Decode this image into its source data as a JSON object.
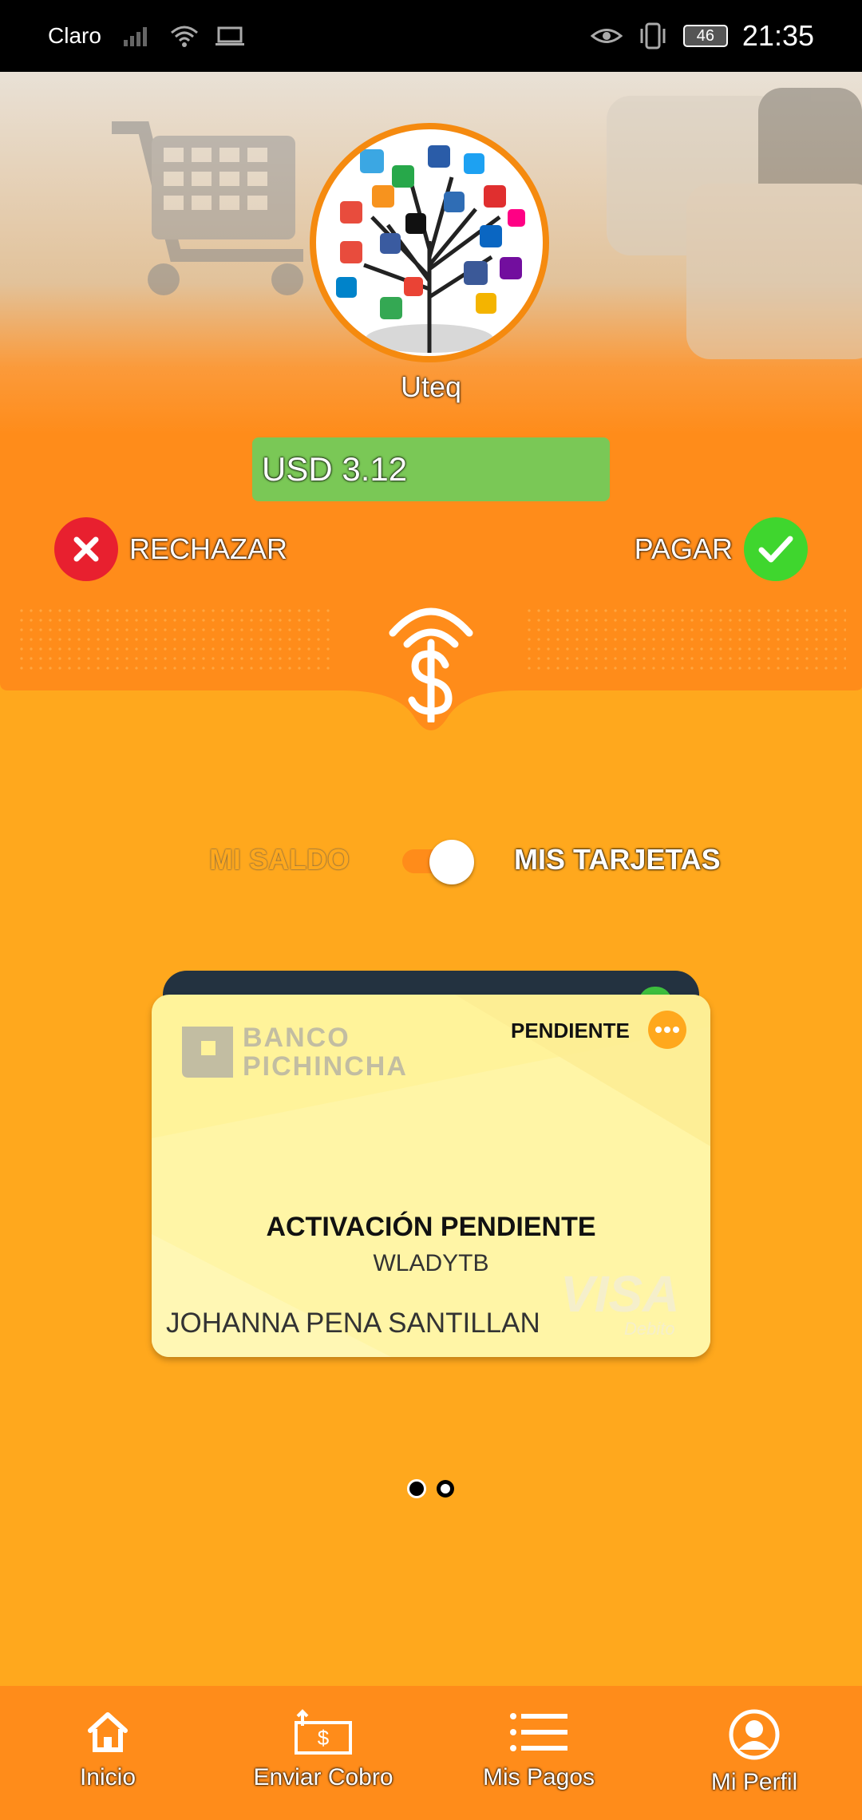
{
  "status_bar": {
    "carrier": "Claro",
    "battery": "46",
    "time": "21:35"
  },
  "merchant": {
    "name": "Uteq",
    "amount": "USD 3.12"
  },
  "actions": {
    "reject_label": "RECHAZAR",
    "pay_label": "PAGAR"
  },
  "toggle": {
    "left_label": "MI SALDO",
    "right_label": "MIS TARJETAS",
    "state": "MIS TARJETAS"
  },
  "card": {
    "bank_line1": "BANCO",
    "bank_line2": "PICHINCHA",
    "status": "PENDIENTE",
    "title": "ACTIVACIÓN PENDIENTE",
    "subtitle": "WLADYTB",
    "holder": "JOHANNA PENA SANTILLAN",
    "brand": "VISA",
    "brand_sub": "Debito"
  },
  "pager": {
    "pages": 2,
    "active": 1
  },
  "bottom_nav": [
    {
      "label": "Inicio",
      "icon": "home-icon"
    },
    {
      "label": "Enviar Cobro",
      "icon": "send-money-icon"
    },
    {
      "label": "Mis Pagos",
      "icon": "list-icon"
    },
    {
      "label": "Mi Perfil",
      "icon": "profile-icon"
    }
  ],
  "colors": {
    "background": "#FFA81D",
    "header_orange": "#FF8C1A",
    "amount_green": "#7AC856",
    "reject_red": "#E8202F",
    "pay_green": "#3FD62E",
    "card_yellow": "#FFF39A"
  }
}
